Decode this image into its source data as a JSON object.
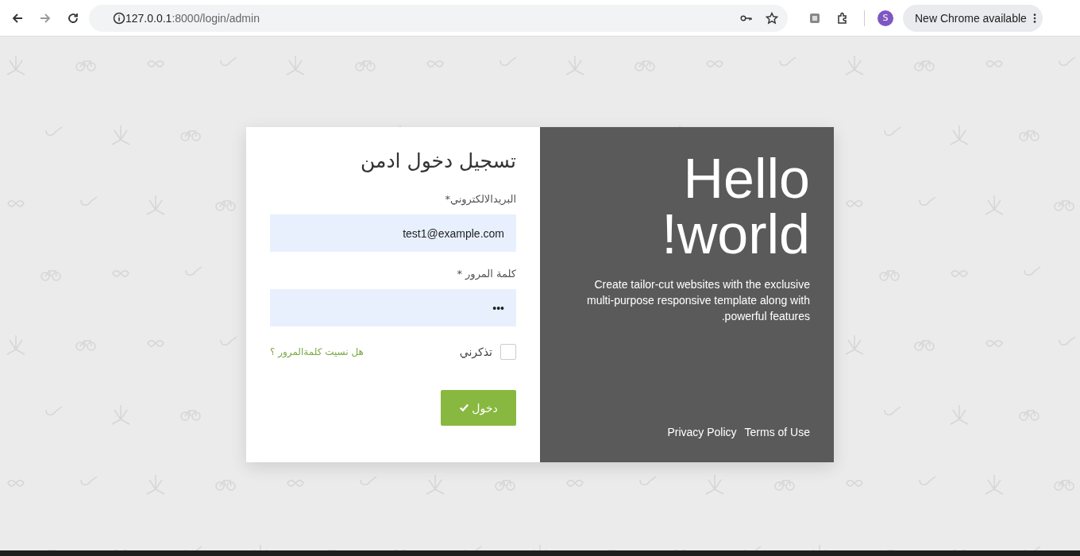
{
  "browser": {
    "url_host": "127.0.0.1",
    "url_rest": ":8000/login/admin",
    "profile_initial": "S",
    "update_label": "New Chrome available"
  },
  "form": {
    "title": "تسجيل دخول ادمن",
    "fields": [
      {
        "label": "البريدالالكتروني*",
        "value": "test1@example.com"
      },
      {
        "label": "كلمة المرور *",
        "value": "•••"
      }
    ],
    "remember": {
      "label": "تذكرني",
      "checked": false
    },
    "forgot_link": "هل نسيت كلمةالمرور ؟",
    "submit": "دخول"
  },
  "hero": {
    "title_lines": [
      "Hello",
      "!world"
    ],
    "text_lines": [
      "Create tailor-cut websites with the exclusive",
      "multi-purpose responsive template along with",
      ".powerful features"
    ],
    "links": [
      "Terms of Use",
      "Privacy Policy"
    ]
  }
}
